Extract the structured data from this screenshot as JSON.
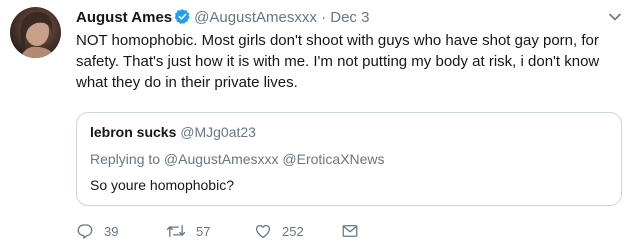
{
  "tweet": {
    "name": "August Ames",
    "handle": "@AugustAmesxxx",
    "separator": "·",
    "date": "Dec 3",
    "text": "NOT homophobic. Most girls don't shoot with guys who have shot gay porn, for safety. That's just how it is with me. I'm not putting my body at risk, i don't know what they do in their private lives."
  },
  "quote": {
    "name": "lebron sucks",
    "handle": "@MJg0at23",
    "replying_to": "Replying to @AugustAmesxxx @EroticaXNews",
    "text": "So youre homophobic?"
  },
  "actions": {
    "reply_count": "39",
    "retweet_count": "57",
    "like_count": "252"
  },
  "colors": {
    "verified_blue": "#1da1f2",
    "muted_text": "#657786",
    "primary_text": "#14171a",
    "border": "#ccd6dd"
  },
  "icons": [
    "verified-badge-icon",
    "chevron-down-icon",
    "reply-icon",
    "retweet-icon",
    "like-icon",
    "message-icon"
  ]
}
